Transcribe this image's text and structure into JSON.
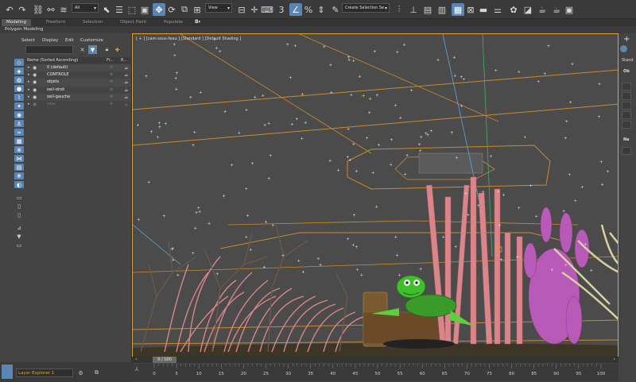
{
  "toolbar": {
    "filter_select": "All",
    "coord_select": "View",
    "named_selection_set": "Create Selection Se",
    "icons": [
      "undo-icon",
      "redo-icon",
      "link-icon",
      "unlink-icon",
      "bind-space-warp-icon",
      "selection-filter",
      "select-object-icon",
      "select-by-name-icon",
      "rectangle-region-icon",
      "window-crossing-icon",
      "move-icon",
      "rotate-icon",
      "scale-icon",
      "pivot-icon",
      "select-manipulate-icon",
      "keyboard-shortcut-icon",
      "snaps-3d-icon",
      "angle-snap-icon",
      "percent-snap-icon",
      "spinner-snap-icon",
      "edit-named-selection-icon",
      "mirror-icon",
      "align-icon",
      "toggle-scene-explorer-icon",
      "toggle-layer-explorer-icon",
      "toggle-ribbon-icon",
      "curve-editor-icon",
      "schematic-view-icon",
      "material-editor-icon",
      "render-setup-icon",
      "rendered-frame-icon",
      "render-icon",
      "render-iterative-icon"
    ]
  },
  "ribbon": {
    "tabs": [
      "Modeling",
      "Freeform",
      "Selection",
      "Object Paint",
      "Populate"
    ],
    "sub_label": "Polygon Modeling"
  },
  "scene_explorer": {
    "menu": [
      "Select",
      "Display",
      "Edit",
      "Customize"
    ],
    "columns": {
      "name": "Name (Sorted Ascending)",
      "frozen": "Fr...",
      "render": "R..."
    },
    "layers": [
      {
        "label": "0 (default)",
        "dim": false
      },
      {
        "label": "CONTROLE",
        "dim": false
      },
      {
        "label": "objets",
        "dim": false
      },
      {
        "label": "oeil-droit",
        "dim": false
      },
      {
        "label": "oeil-gauche",
        "dim": false
      },
      {
        "label": "ssss",
        "dim": true
      }
    ]
  },
  "viewport": {
    "label": "[ + ] [cam-sous-feau ] [Standard ] [Default Shading ]",
    "selection_color": "#e0a230"
  },
  "command_panel": {
    "create_label": "+",
    "standard_label": "Stand",
    "object_type": "Ob",
    "name_color": "Na"
  },
  "timeline": {
    "current": "0 / 100",
    "ticks": [
      "0",
      "5",
      "10",
      "15",
      "20",
      "25",
      "30",
      "35",
      "40",
      "45",
      "50",
      "55",
      "60",
      "65",
      "70",
      "75",
      "80",
      "85",
      "90",
      "95",
      "100"
    ]
  },
  "status": {
    "layer_explorer": "Layer Explorer 1"
  },
  "colors": {
    "accent": "#5b86b3",
    "selection": "#e0a230",
    "background": "#444444"
  }
}
